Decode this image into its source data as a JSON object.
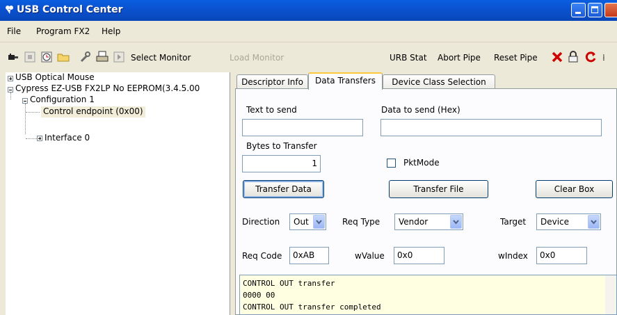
{
  "window": {
    "title": "USB Control Center"
  },
  "menu": {
    "items": [
      "File",
      "Program FX2",
      "Help"
    ]
  },
  "toolbar": {
    "icons": [
      "plug-icon",
      "stop-icon",
      "clock-icon",
      "folder-icon",
      "wrench-icon",
      "printer-icon",
      "play-icon"
    ],
    "select_monitor": "Select Monitor",
    "load_monitor": "Load Monitor",
    "urb_stat": "URB Stat",
    "abort_pipe": "Abort Pipe",
    "reset_pipe": "Reset Pipe",
    "right_icons": [
      "red-x-icon",
      "lock-icon",
      "refresh-icon"
    ]
  },
  "tree": {
    "items": [
      {
        "label": "USB Optical Mouse"
      },
      {
        "label": "Cypress EZ-USB FX2LP No EEPROM(3.4.5.00"
      },
      {
        "label": "Configuration 1"
      },
      {
        "label": "Control endpoint (0x00)"
      },
      {
        "label": "Interface 0"
      }
    ]
  },
  "tabs": [
    "Descriptor Info",
    "Data Transfers",
    "Device Class Selection"
  ],
  "active_tab": "Data Transfers",
  "transfer": {
    "text_to_send_label": "Text to send",
    "text_to_send_value": "",
    "data_to_send_label": "Data to send (Hex)",
    "data_to_send_value": "",
    "bytes_label": "Bytes to Transfer",
    "bytes_value": "1",
    "pktmode_label": "PktMode",
    "pktmode_checked": false,
    "transfer_data": "Transfer Data",
    "transfer_file": "Transfer File",
    "clear_box": "Clear Box",
    "direction_label": "Direction",
    "direction_value": "Out",
    "req_type_label": "Req Type",
    "req_type_value": "Vendor",
    "target_label": "Target",
    "target_value": "Device",
    "req_code_label": "Req Code",
    "req_code_value": "0xAB",
    "wvalue_label": "wValue",
    "wvalue_value": "0x0",
    "windex_label": "wIndex",
    "windex_value": "0x0"
  },
  "output": {
    "lines": [
      "CONTROL OUT transfer",
      "0000 00",
      "CONTROL OUT transfer completed"
    ]
  }
}
